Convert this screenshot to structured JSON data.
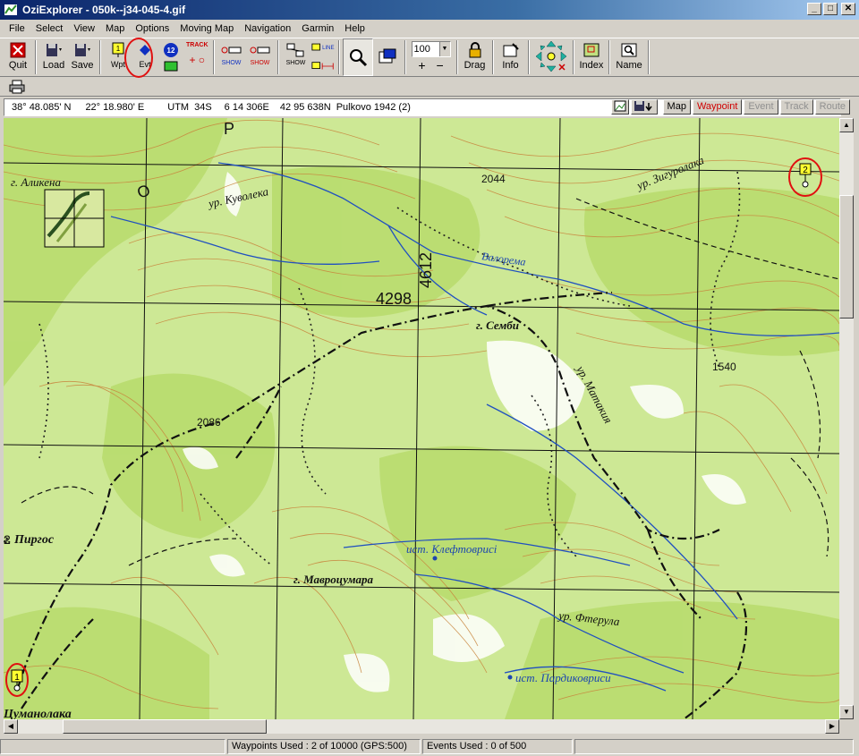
{
  "window": {
    "title": "OziExplorer - 050k--j34-045-4.gif"
  },
  "menu": [
    "File",
    "Select",
    "View",
    "Map",
    "Options",
    "Moving Map",
    "Navigation",
    "Garmin",
    "Help"
  ],
  "toolbar": {
    "quit": "Quit",
    "load": "Load",
    "save": "Save",
    "wpt": "Wpt",
    "evt": "Evt",
    "track": "TRACK",
    "line": "LINE",
    "show": "SHOW",
    "zoom_value": "100",
    "drag": "Drag",
    "info": "Info",
    "index": "Index",
    "name": "Name"
  },
  "coords": {
    "lat": "38° 48.085' N",
    "lon": "22° 18.980' E",
    "utm_label": "UTM",
    "zone": "34S",
    "easting": "6 14 306E",
    "northing": "42 95 638N",
    "datum": "Pulkovo 1942 (2)"
  },
  "view_tabs": {
    "map": "Map",
    "waypoint": "Waypoint",
    "event": "Event",
    "track": "Track",
    "route": "Route"
  },
  "map_labels": {
    "alikena": "г. Аликена",
    "kuvoleka": "ур. Куволека",
    "zigurolaka": "ур. Зигуролака",
    "h2044": "2044",
    "valorema": "Валорема",
    "h4298": "4298",
    "h4612": "4612",
    "sembi": "г. Семби",
    "h1540": "1540",
    "matakia": "ур. Матакия",
    "h2086": "2086",
    "pirgos": "г. Пиргос",
    "kleftovrisi": "ист. Клефтоврисi",
    "mavrotsumara": "г. Мавроцумара",
    "fterula": "ур. Фтерула",
    "pardikovrisi": "ист. Пардиковриси",
    "tsumanolaka": "Цуманолака",
    "letter_r": "Р",
    "letter_o": "О",
    "number_2": "2"
  },
  "waypoints": [
    {
      "label": "1"
    },
    {
      "label": "2"
    }
  ],
  "status": {
    "waypoints": "Waypoints Used : 2 of 10000  (GPS:500)",
    "events": "Events Used : 0 of 500"
  },
  "colors": {
    "highlight": "#e01010",
    "title_bar": "#0a246a",
    "waypoint_flag": "#ffff30"
  }
}
